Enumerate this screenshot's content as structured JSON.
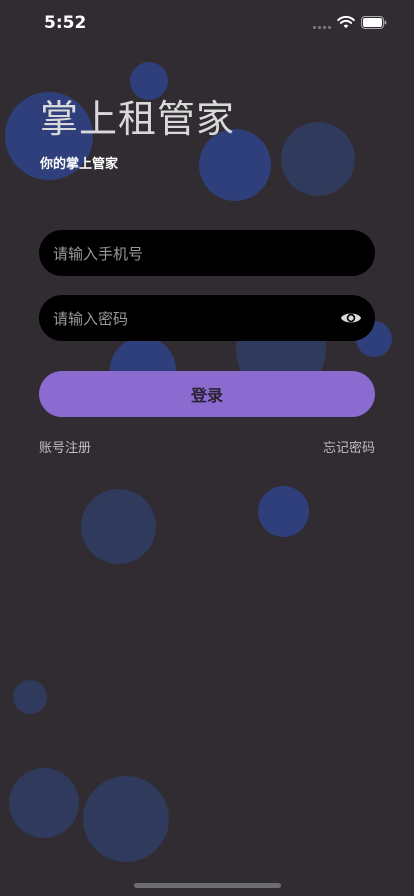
{
  "status_bar": {
    "time": "5:52"
  },
  "header": {
    "title": "掌上租管家",
    "subtitle": "你的掌上管家"
  },
  "form": {
    "phone_placeholder": "请输入手机号",
    "password_placeholder": "请输入密码",
    "login_label": "登录"
  },
  "links": {
    "register": "账号注册",
    "forgot_password": "忘记密码"
  },
  "icons": {
    "wifi": "wifi-icon",
    "battery": "battery-icon",
    "password_toggle": "eye-icon"
  },
  "colors": {
    "background": "#302c31",
    "accent": "#8b6bd0",
    "input_background": "#000000",
    "bubble": "#2f3f7c"
  }
}
